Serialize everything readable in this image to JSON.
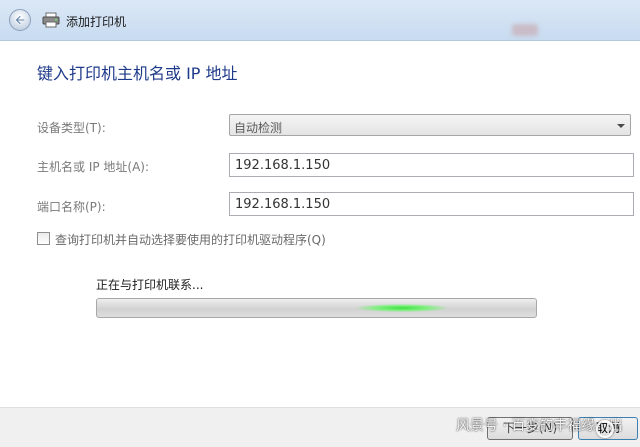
{
  "window": {
    "title": "添加打印机"
  },
  "heading": "键入打印机主机名或 IP 地址",
  "fields": {
    "device_type": {
      "label": "设备类型(T):",
      "value": "自动检测"
    },
    "hostname": {
      "label": "主机名或 IP 地址(A):",
      "value": "192.168.1.150"
    },
    "port_name": {
      "label": "端口名称(P):",
      "value": "192.168.1.150"
    }
  },
  "checkbox": {
    "label": "查询打印机并自动选择要使用的打印机驱动程序(Q)",
    "checked": false
  },
  "status": {
    "text": "正在与打印机联系..."
  },
  "buttons": {
    "next": "下一步(N)",
    "cancel": "取消"
  },
  "watermark": "风景号 · 百变的丰福缘 · 出",
  "icons": {
    "back": "back-arrow-icon",
    "printer": "printer-icon"
  },
  "colors": {
    "heading": "#1e3a8a",
    "progress_glow": "#3ee03e"
  }
}
